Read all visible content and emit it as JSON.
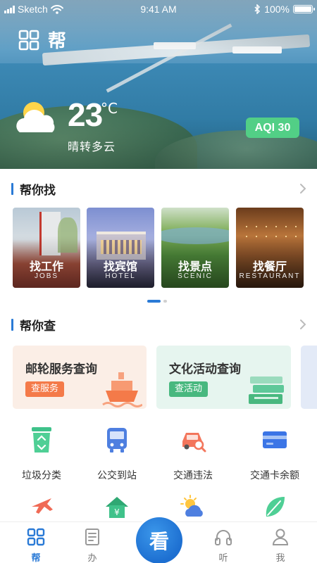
{
  "status_bar": {
    "carrier": "Sketch",
    "time": "9:41 AM",
    "battery": "100%",
    "battery_level": 1.0
  },
  "header": {
    "app_title": "帮",
    "weather_icon": "partly-cloudy-icon",
    "temperature": "23",
    "temperature_unit": "°C",
    "weather_text": "晴转多云",
    "aqi_label": "AQI 30",
    "aqi_color": "#52cf86"
  },
  "find_section": {
    "title": "帮你找",
    "cards": [
      {
        "label": "找工作",
        "sub": "JOBS"
      },
      {
        "label": "找宾馆",
        "sub": "HOTEL"
      },
      {
        "label": "找景点",
        "sub": "SCENIC"
      },
      {
        "label": "找餐厅",
        "sub": "RESTAURANT"
      }
    ],
    "pager": {
      "current": 1,
      "total": 2
    }
  },
  "query_section": {
    "title": "帮你查",
    "cards": [
      {
        "title": "邮轮服务查询",
        "button": "查服务",
        "icon": "cruise-ship-icon",
        "bg": "#fbeee6",
        "btn_color": "#f47a49"
      },
      {
        "title": "文化活动查询",
        "button": "查活动",
        "icon": "books-icon",
        "bg": "#e6f5ef",
        "btn_color": "#48b87f"
      }
    ]
  },
  "services": [
    {
      "label": "垃圾分类",
      "icon": "recycle-bin-icon"
    },
    {
      "label": "公交到站",
      "icon": "bus-icon"
    },
    {
      "label": "交通违法",
      "icon": "car-search-icon"
    },
    {
      "label": "交通卡余额",
      "icon": "transit-card-icon"
    },
    {
      "label": "",
      "icon": "airplane-icon"
    },
    {
      "label": "",
      "icon": "house-money-icon"
    },
    {
      "label": "",
      "icon": "sun-cloud-icon"
    },
    {
      "label": "",
      "icon": "leaf-icon"
    }
  ],
  "tab_bar": {
    "tabs": [
      {
        "label": "帮",
        "icon": "grid-icon",
        "active": true
      },
      {
        "label": "办",
        "icon": "document-icon",
        "active": false
      },
      {
        "label": "看",
        "icon": "center-logo-icon",
        "active": false
      },
      {
        "label": "听",
        "icon": "headphones-icon",
        "active": false
      },
      {
        "label": "我",
        "icon": "user-icon",
        "active": false
      }
    ]
  },
  "colors": {
    "accent": "#2a7ad6"
  }
}
